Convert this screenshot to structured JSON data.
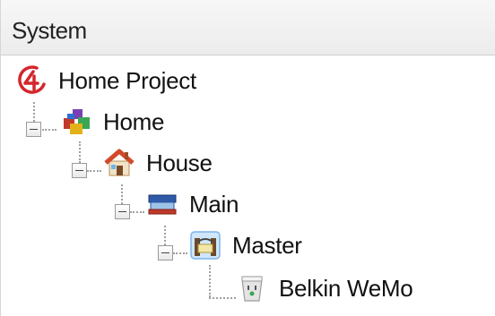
{
  "panel": {
    "title": "System"
  },
  "tree": {
    "root": {
      "label": "Home Project",
      "icon": "project-logo-icon"
    },
    "home": {
      "label": "Home",
      "icon": "blocks-icon"
    },
    "house": {
      "label": "House",
      "icon": "house-icon"
    },
    "main": {
      "label": "Main",
      "icon": "floor-icon"
    },
    "master": {
      "label": "Master",
      "icon": "room-icon"
    },
    "device": {
      "label": "Belkin WeMo",
      "icon": "wemo-device-icon"
    }
  }
}
